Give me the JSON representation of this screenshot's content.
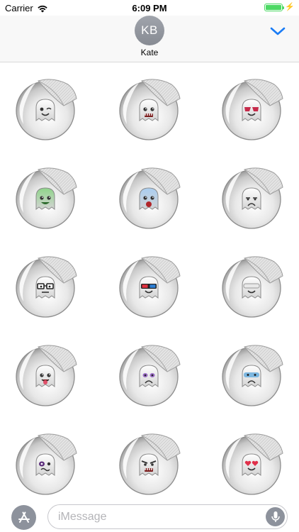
{
  "status_bar": {
    "carrier": "Carrier",
    "time": "6:09 PM",
    "battery_level": 1.0
  },
  "header": {
    "avatar_initials": "KB",
    "contact_name": "Kate",
    "collapse_icon": "chevron-down-icon",
    "accent_color": "#1a7cf5"
  },
  "stickers": [
    {
      "name": "ghost-wink",
      "eyes": "wink",
      "mouth": "smile",
      "tint": "#ffffff"
    },
    {
      "name": "ghost-teeth",
      "eyes": "round",
      "mouth": "teeth",
      "tint": "#ffffff"
    },
    {
      "name": "ghost-red-glasses",
      "eyes": "redglasses",
      "mouth": "smile",
      "tint": "#ffffff"
    },
    {
      "name": "ghost-green",
      "eyes": "round",
      "mouth": "grin",
      "tint": "#8fd48a"
    },
    {
      "name": "ghost-blue-shout",
      "eyes": "round",
      "mouth": "open",
      "tint": "#a9cdf0"
    },
    {
      "name": "ghost-sad",
      "eyes": "sleepy",
      "mouth": "frown",
      "tint": "#ffffff"
    },
    {
      "name": "ghost-nerd",
      "eyes": "glasses",
      "mouth": "flat",
      "tint": "#ffffff"
    },
    {
      "name": "ghost-3d",
      "eyes": "3d",
      "mouth": "smile",
      "tint": "#ffffff"
    },
    {
      "name": "ghost-cool",
      "eyes": "visor",
      "mouth": "smile",
      "tint": "#ffffff"
    },
    {
      "name": "ghost-tongue",
      "eyes": "round",
      "mouth": "tongue",
      "tint": "#ffffff"
    },
    {
      "name": "ghost-purple-sad",
      "eyes": "purple",
      "mouth": "frown",
      "tint": "#ffffff"
    },
    {
      "name": "ghost-blue-sad",
      "eyes": "bluemask",
      "mouth": "frown",
      "tint": "#ffffff"
    },
    {
      "name": "ghost-black-eye",
      "eyes": "blackeye",
      "mouth": "wavy",
      "tint": "#ffffff"
    },
    {
      "name": "ghost-angry",
      "eyes": "angry",
      "mouth": "teeth",
      "tint": "#ffffff"
    },
    {
      "name": "ghost-love",
      "eyes": "hearts",
      "mouth": "smile",
      "tint": "#ffffff"
    }
  ],
  "compose": {
    "placeholder": "iMessage",
    "value": "",
    "app_store_icon": "app-store-icon",
    "mic_icon": "microphone-icon"
  }
}
